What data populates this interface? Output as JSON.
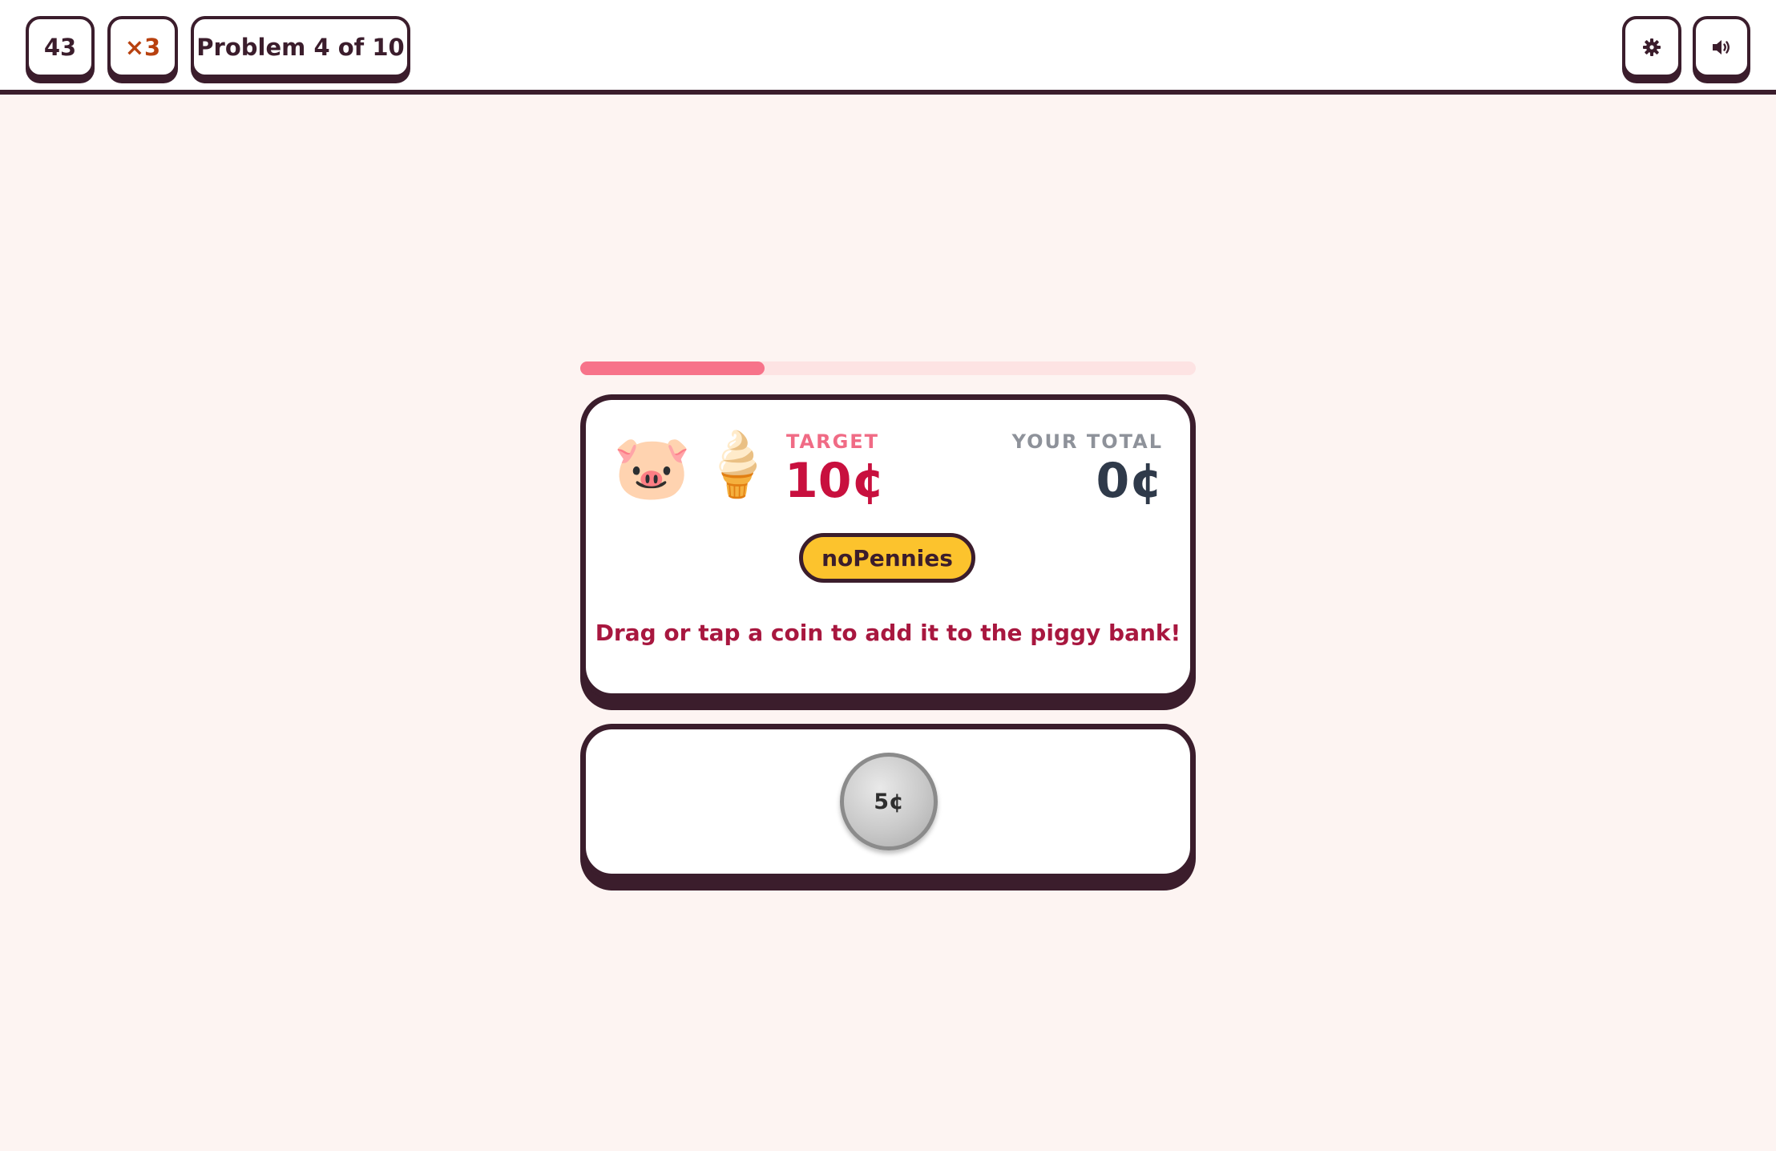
{
  "header": {
    "score": "43",
    "streak": "×3",
    "problem_label": "Problem 4 of 10",
    "settings_icon": "gear-icon",
    "sound_icon": "speaker-icon"
  },
  "progress": {
    "fraction": 0.3
  },
  "problem": {
    "items": [
      "🐷",
      "🍦"
    ],
    "target_label": "TARGET",
    "target_value": "10¢",
    "total_label": "YOUR TOTAL",
    "total_value": "0¢",
    "rule_tag": "noPennies",
    "instruction": "Drag or tap a coin to add it to the piggy bank!"
  },
  "coins": [
    {
      "label": "5¢"
    }
  ],
  "colors": {
    "background": "#fdf4f2",
    "outline": "#3b1d2c",
    "progress": "#f7738a",
    "target": "#c8103e",
    "tag": "#fcc32d"
  }
}
